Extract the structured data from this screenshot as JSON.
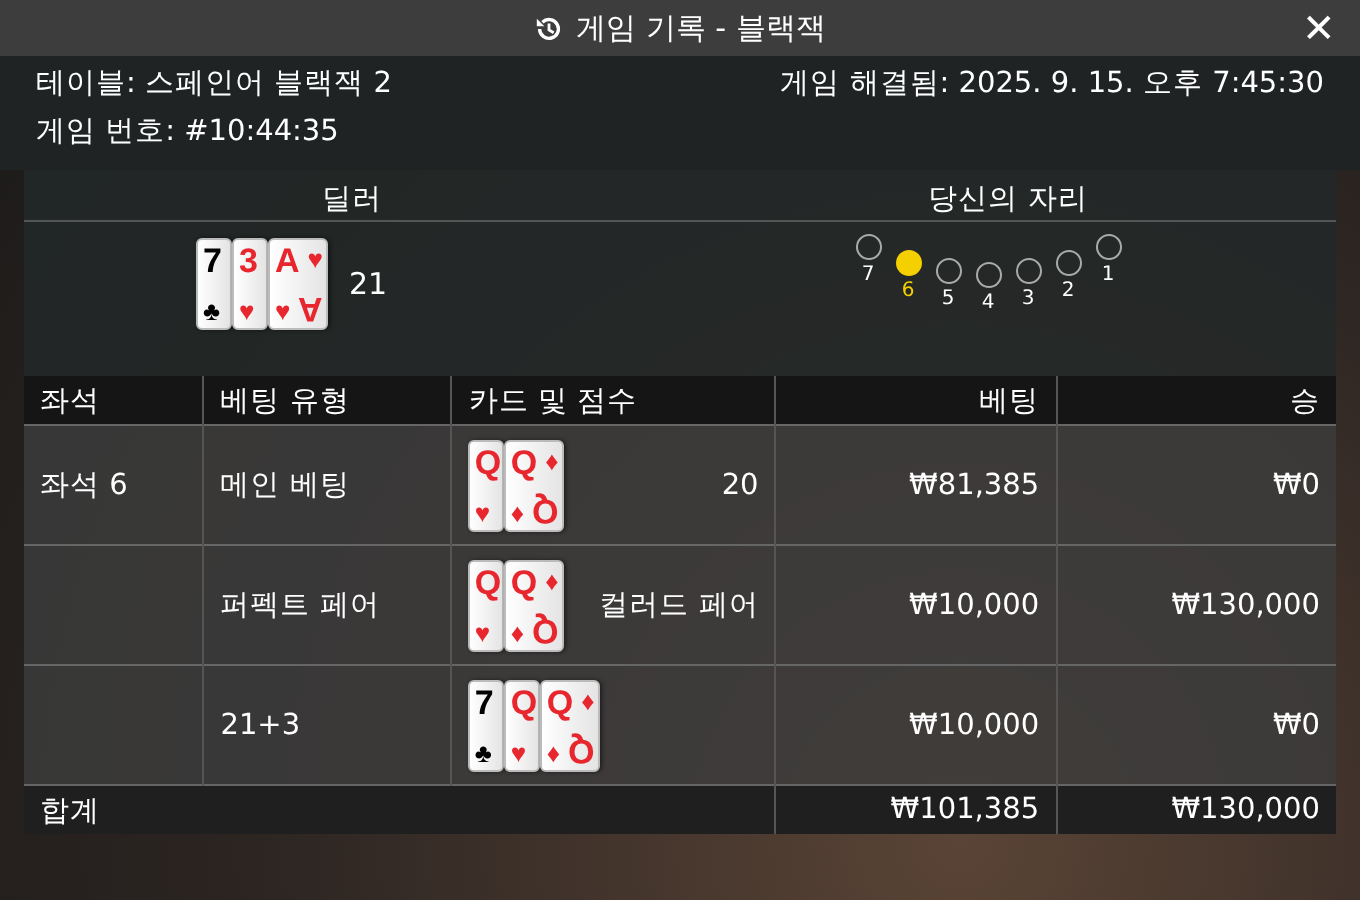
{
  "window": {
    "title": "게임 기록 - 블랙잭",
    "close": "✕"
  },
  "info": {
    "table": "테이블: 스페인어 블랙잭 2",
    "game_number": "게임 번호: #10:44:35",
    "resolved": "게임 해결됨: 2025. 9. 15. 오후 7:45:30"
  },
  "dealer": {
    "heading": "딜러",
    "score": "21",
    "cards": [
      {
        "rank": "7",
        "suit": "♣",
        "color": "#000000"
      },
      {
        "rank": "3",
        "suit": "♥",
        "color": "#e8262e"
      },
      {
        "rank": "A",
        "suit": "♥",
        "color": "#e8262e",
        "corner_suit": "♥",
        "corner_rank": "A"
      }
    ]
  },
  "your_seat": {
    "heading": "당신의 자리",
    "seats": [
      {
        "label": "7",
        "selected": false
      },
      {
        "label": "6",
        "selected": true
      },
      {
        "label": "5",
        "selected": false
      },
      {
        "label": "4",
        "selected": false
      },
      {
        "label": "3",
        "selected": false
      },
      {
        "label": "2",
        "selected": false
      },
      {
        "label": "1",
        "selected": false
      }
    ]
  },
  "table": {
    "columns": [
      "좌석",
      "베팅 유형",
      "카드 및 점수",
      "베팅",
      "승"
    ],
    "rows": [
      {
        "seat": "좌석 6",
        "bet_type": "메인 베팅",
        "result": "20",
        "bet": "₩81,385",
        "win": "₩0",
        "cards": [
          {
            "rank": "Q",
            "suit": "♥",
            "color": "#e8262e"
          },
          {
            "rank": "Q",
            "suit": "♦",
            "color": "#e8262e",
            "corner_suit": "♦",
            "corner_rank": "Q"
          }
        ]
      },
      {
        "bet_type": "퍼펙트 페어",
        "result": "컬러드 페어",
        "bet": "₩10,000",
        "win": "₩130,000",
        "cards": [
          {
            "rank": "Q",
            "suit": "♥",
            "color": "#e8262e"
          },
          {
            "rank": "Q",
            "suit": "♦",
            "color": "#e8262e",
            "corner_suit": "♦",
            "corner_rank": "Q"
          }
        ]
      },
      {
        "bet_type": "21+3",
        "bet": "₩10,000",
        "win": "₩0",
        "cards": [
          {
            "rank": "7",
            "suit": "♣",
            "color": "#000000"
          },
          {
            "rank": "Q",
            "suit": "♥",
            "color": "#e8262e"
          },
          {
            "rank": "Q",
            "suit": "♦",
            "color": "#e8262e",
            "corner_suit": "♦",
            "corner_rank": "Q"
          }
        ]
      }
    ],
    "total": {
      "label": "합계",
      "bet": "₩101,385",
      "win": "₩130,000"
    }
  }
}
